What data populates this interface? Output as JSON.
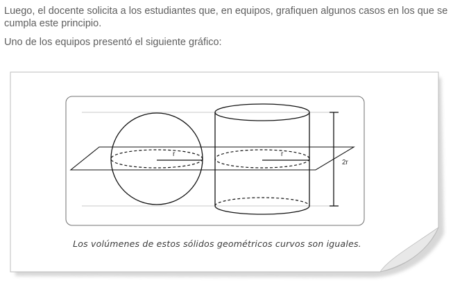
{
  "text": {
    "paragraph1": "Luego, el docente solicita a los estudiantes que, en equipos, grafiquen algunos casos en los que se cumpla este principio.",
    "paragraph2": "Uno de los equipos presentó el siguiente gráfico:"
  },
  "figure": {
    "radius_label_sphere": "r",
    "radius_label_cylinder": "r",
    "height_label": "2r",
    "caption": "Los volúmenes de estos sólidos geométricos curvos son iguales."
  }
}
